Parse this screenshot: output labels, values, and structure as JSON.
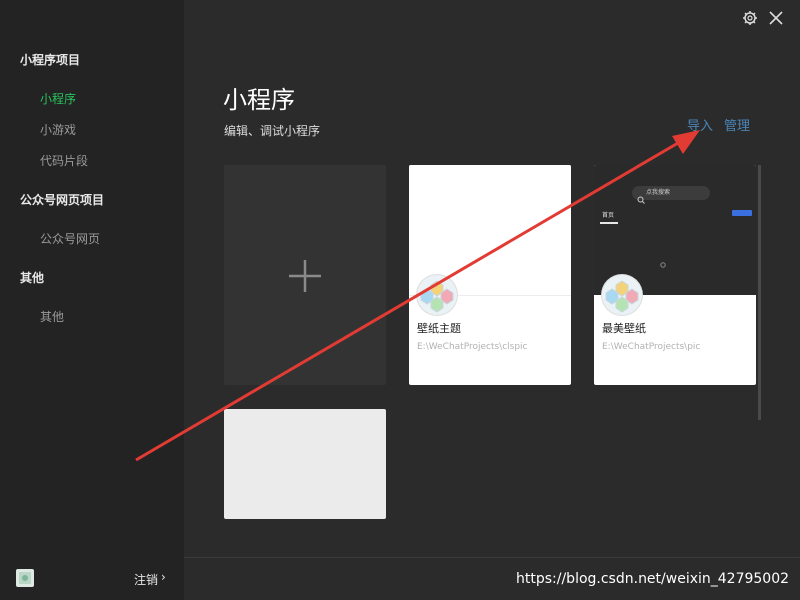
{
  "sidebar": {
    "sections": [
      {
        "title": "小程序项目",
        "items": [
          {
            "label": "小程序",
            "active": true
          },
          {
            "label": "小游戏",
            "active": false
          },
          {
            "label": "代码片段",
            "active": false
          }
        ]
      },
      {
        "title": "公众号网页项目",
        "items": [
          {
            "label": "公众号网页",
            "active": false
          }
        ]
      },
      {
        "title": "其他",
        "items": [
          {
            "label": "其他",
            "active": false
          }
        ]
      }
    ],
    "footer": {
      "logout_label": "注销",
      "chevron": "›",
      "avatar_icon": "user-avatar-icon"
    }
  },
  "header": {
    "icons": [
      "settings-icon",
      "close-icon"
    ],
    "title": "小程序",
    "subtitle": "编辑、调试小程序",
    "actions": {
      "import_label": "导入",
      "manage_label": "管理"
    }
  },
  "projects": [
    {
      "name": "壁纸主题",
      "path": "E:\\WeChatProjects\\clspic"
    },
    {
      "name": "最美壁纸",
      "path": "E:\\WeChatProjects\\pic"
    }
  ],
  "preview": {
    "search_placeholder": "点我搜索",
    "tab_home": "首页"
  },
  "colors": {
    "accent_green": "#29c25d",
    "link_blue": "#4b86b8",
    "annotation_red": "#e23b34"
  },
  "watermark": "https://blog.csdn.net/weixin_42795002"
}
